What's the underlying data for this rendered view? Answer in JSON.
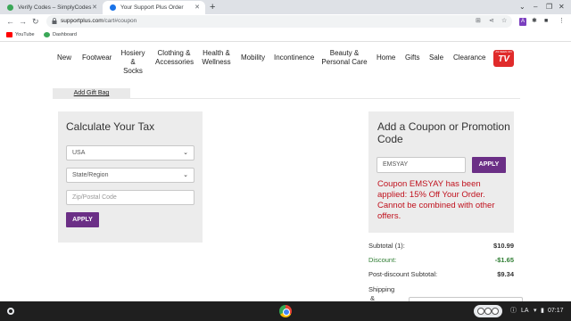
{
  "browser": {
    "tabs": [
      {
        "title": "Verify Codes – SimplyCodes",
        "active": false,
        "favicon_color": "#3aa757"
      },
      {
        "title": "Your Support Plus Order",
        "active": true,
        "favicon_color": "#1a73e8"
      }
    ],
    "new_tab_symbol": "+",
    "url_domain": "supportplus.com",
    "url_path": "/cart#coupon",
    "bookmarks": [
      {
        "label": "YouTube",
        "icon_color": "#ff0000"
      },
      {
        "label": "Dashboard",
        "icon_color": "#3aa757"
      }
    ]
  },
  "site_nav": {
    "items": [
      {
        "line1": "New",
        "line2": ""
      },
      {
        "line1": "Footwear",
        "line2": ""
      },
      {
        "line1": "Hosiery",
        "line2": "& Socks"
      },
      {
        "line1": "Clothing &",
        "line2": "Accessories"
      },
      {
        "line1": "Health &",
        "line2": "Wellness"
      },
      {
        "line1": "Mobility",
        "line2": ""
      },
      {
        "line1": "Incontinence",
        "line2": ""
      },
      {
        "line1": "Beauty &",
        "line2": "Personal Care"
      },
      {
        "line1": "Home",
        "line2": ""
      },
      {
        "line1": "Gifts",
        "line2": ""
      },
      {
        "line1": "Sale",
        "line2": ""
      },
      {
        "line1": "Clearance",
        "line2": ""
      }
    ],
    "logo": {
      "top_text": "AS SEEN ON",
      "main_text": "TV",
      "color": "#e02b2b"
    }
  },
  "gift_bag_link": "Add Gift Bag",
  "tax_panel": {
    "title": "Calculate Your Tax",
    "country": "USA",
    "state_placeholder": "State/Region",
    "zip_placeholder": "Zip/Postal Code",
    "apply_label": "APPLY"
  },
  "coupon_panel": {
    "title_line1": "Add a Coupon or Promotion",
    "title_line2": "Code",
    "code_value": "EMSYAY",
    "apply_label": "APPLY",
    "message": "Coupon EMSYAY has been applied: 15% Off Your Order. Cannot be combined with other offers."
  },
  "summary": {
    "subtotal_label": "Subtotal (1):",
    "subtotal_value": "$10.99",
    "discount_label": "Discount:",
    "discount_value": "-$1.65",
    "post_discount_label": "Post-discount Subtotal:",
    "post_discount_value": "$9.34",
    "shipping_label_line1": "Shipping",
    "shipping_label_line2": "&"
  },
  "taskbar": {
    "keyboard": "LA",
    "time": "07:17"
  },
  "colors": {
    "brand_purple": "#6b2f86",
    "error_red": "#c0121e",
    "discount_green": "#2e7d32"
  }
}
